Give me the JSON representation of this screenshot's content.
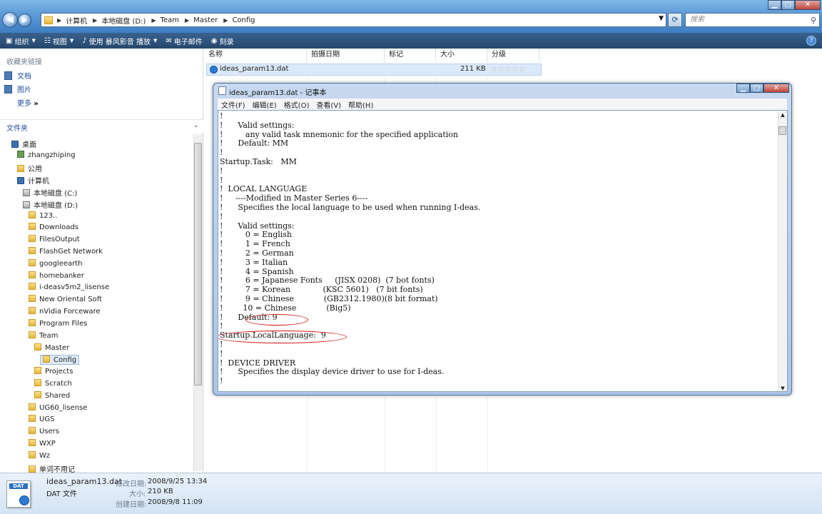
{
  "window": {
    "nav_back": "◀",
    "nav_forward": "▶"
  },
  "address": {
    "crumbs": [
      "计算机",
      "本地磁盘 (D:)",
      "Team",
      "Master",
      "Config"
    ]
  },
  "search": {
    "placeholder": "搜索"
  },
  "toolbar": {
    "organize": "组织",
    "views": "视图",
    "open_with": "使用 暴风影音 播放",
    "email": "电子邮件",
    "burn": "刻录"
  },
  "left": {
    "favorites_title": "收藏夹链接",
    "favorites": [
      "文档",
      "图片",
      "更多"
    ],
    "folders_title": "文件夹",
    "tree": [
      "桌面",
      "zhangzhiping",
      "公用",
      "计算机",
      "本地磁盘 (C:)",
      "本地磁盘 (D:)",
      "123..",
      "Downloads",
      "FilesOutput",
      "FlashGet Network",
      "googleearth",
      "homebanker",
      "i-deasv5m2_lisense",
      "New Oriental Soft",
      "nVidia Forceware",
      "Program Files",
      "Team",
      "Master",
      "Config",
      "Projects",
      "Scratch",
      "Shared",
      "UG60_lisense",
      "UGS",
      "Users",
      "WXP",
      "Wz",
      "单词不用记"
    ]
  },
  "columns": {
    "name": "名称",
    "date_taken": "拍摄日期",
    "tags": "标记",
    "size": "大小",
    "rating": "分级"
  },
  "file": {
    "name": "ideas_param13.dat",
    "size": "211 KB",
    "rating_stars": 0
  },
  "status": {
    "icon_label": "DAT",
    "filename": "ideas_param13.dat",
    "modified_label": "修改日期:",
    "modified": "2008/9/25 13:34",
    "type": "DAT 文件",
    "size_label": "大小:",
    "size": "210 KB",
    "created_label": "创建日期:",
    "created": "2008/9/8 11:09"
  },
  "notepad": {
    "title": "ideas_param13.dat - 记事本",
    "menu": [
      "文件(F)",
      "编辑(E)",
      "格式(O)",
      "查看(V)",
      "帮助(H)"
    ],
    "lines": [
      "!",
      "!      Valid settings:",
      "!         any valid task mnemonic for the specified application",
      "!      Default: MM",
      "!",
      "Startup.Task:   MM",
      "!",
      "!",
      "!  LOCAL LANGUAGE",
      "!     ----Modified in Master Series 6----",
      "!      Specifies the local language to be used when running I-deas.",
      "!",
      "!      Valid settings:",
      "!         0 = English",
      "!         1 = French",
      "!         2 = German",
      "!         3 = Italian",
      "!         4 = Spanish",
      "!         6 = Japanese Fonts     (JISX 0208)  (7 bot fonts)",
      "!         7 = Korean             (KSC 5601)   (7 bit fonts)",
      "!         9 = Chinese            (GB2312.1980)(8 bit format)",
      "!        10 = Chinese            (Big5)",
      "!      Default: 9",
      "!",
      "Startup.LocalLanguage:  9",
      "!",
      "!",
      "!  DEVICE DRIVER",
      "!      Specifies the display device driver to use for I-deas.",
      "!"
    ]
  }
}
